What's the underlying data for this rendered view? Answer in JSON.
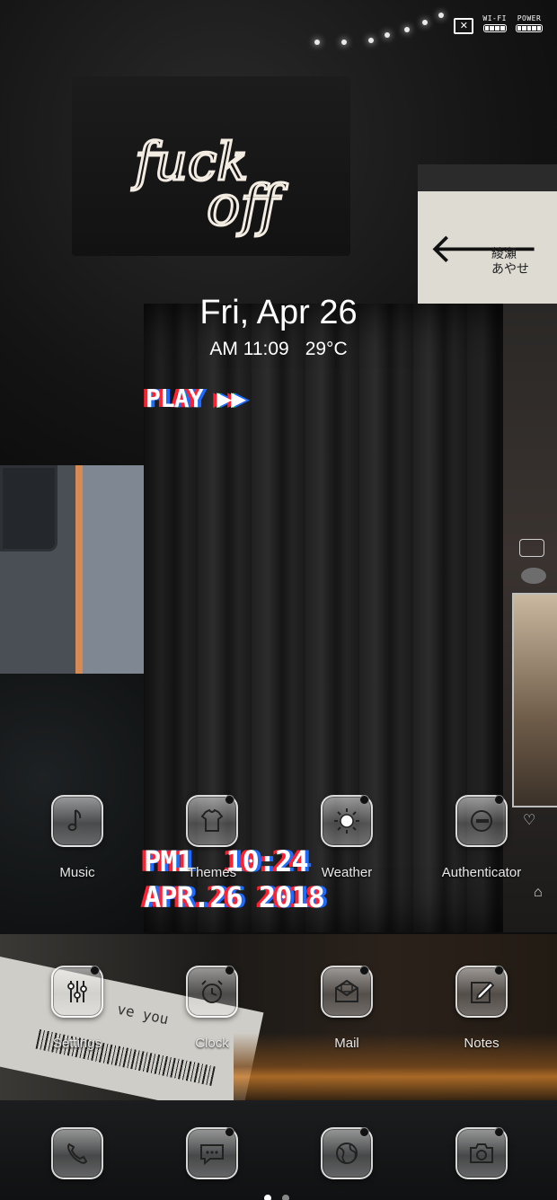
{
  "status_bar": {
    "notification_icon": "close-box-icon",
    "wifi_label": "WI-FI",
    "power_label": "POWER"
  },
  "widget": {
    "date": "Fri, Apr 26",
    "time": "AM 11:09",
    "temperature": "29°C"
  },
  "glitch": {
    "play": "PLAY",
    "time": "PM1  10:24",
    "date": "APR.26 2018"
  },
  "background": {
    "neon_text": "fuck off",
    "sign_text": [
      "綾瀬",
      "あやせ"
    ],
    "ticket_text": "ve you"
  },
  "apps": [
    {
      "label": "Music",
      "icon": "music-note-icon"
    },
    {
      "label": "Themes",
      "icon": "tshirt-icon"
    },
    {
      "label": "Weather",
      "icon": "sun-icon"
    },
    {
      "label": "Authenticator",
      "icon": "authenticator-icon"
    },
    {
      "label": "Settings",
      "icon": "sliders-icon"
    },
    {
      "label": "Clock",
      "icon": "alarm-clock-icon"
    },
    {
      "label": "Mail",
      "icon": "mail-icon"
    },
    {
      "label": "Notes",
      "icon": "note-pencil-icon"
    }
  ],
  "dock": [
    {
      "icon": "phone-icon"
    },
    {
      "icon": "message-icon"
    },
    {
      "icon": "browser-globe-icon"
    },
    {
      "icon": "camera-icon"
    }
  ],
  "pages": {
    "count": 2,
    "current": 1
  }
}
